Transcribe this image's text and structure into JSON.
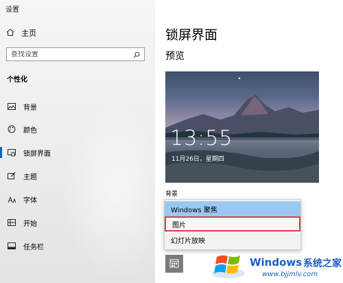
{
  "window": {
    "title": "设置"
  },
  "sidebar": {
    "home_label": "主页",
    "search_placeholder": "查找设置",
    "section_label": "个性化",
    "items": [
      {
        "label": "背景",
        "icon": "image-icon"
      },
      {
        "label": "颜色",
        "icon": "palette-icon"
      },
      {
        "label": "锁屏界面",
        "icon": "lock-screen-icon",
        "active": true
      },
      {
        "label": "主题",
        "icon": "theme-brush-icon"
      },
      {
        "label": "字体",
        "icon": "font-icon"
      },
      {
        "label": "开始",
        "icon": "start-icon"
      },
      {
        "label": "任务栏",
        "icon": "taskbar-icon"
      }
    ]
  },
  "main": {
    "title": "锁屏界面",
    "preview_label": "预览",
    "lock_time": "13:55",
    "lock_date": "11月26日，星期四",
    "background_label": "背景",
    "background_options": [
      {
        "label": "Windows 聚焦",
        "selected": true
      },
      {
        "label": "图片",
        "highlighted": true
      },
      {
        "label": "幻灯片放映"
      }
    ]
  },
  "watermark": {
    "brand": "Windows",
    "suffix": "系统之家",
    "url": "www.bjjmlv.com"
  },
  "colors": {
    "accent": "#0067c0",
    "selected_option": "#99c9f2",
    "highlight_border": "#e03b46",
    "watermark_blue": "#1b5fc1"
  }
}
